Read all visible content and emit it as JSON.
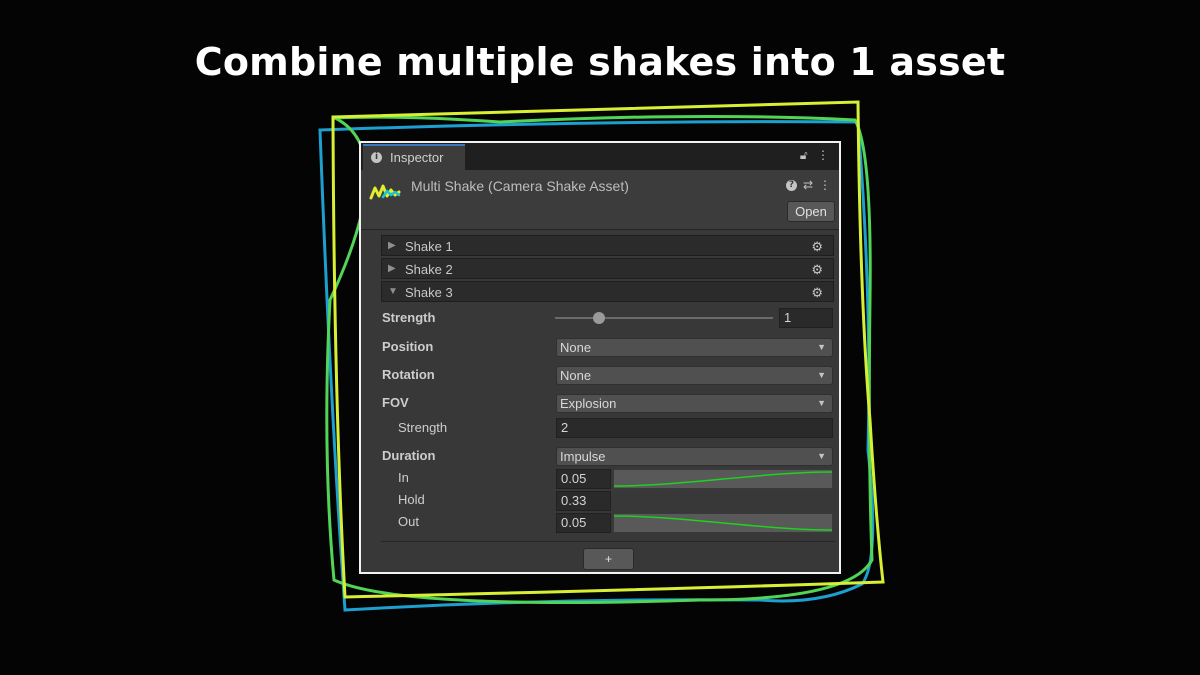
{
  "headline": "Combine multiple shakes into 1 asset",
  "inspector": {
    "tab_label": "Inspector",
    "tab_icon": "info-icon",
    "tab_tools": [
      "lock-icon",
      "kebab-menu-icon"
    ],
    "asset_title": "Multi Shake (Camera Shake Asset)",
    "header_tools": [
      "help-icon",
      "preset-settings-icon",
      "kebab-menu-icon"
    ],
    "open_label": "Open",
    "shakes": [
      {
        "label": "Shake 1",
        "expanded": false
      },
      {
        "label": "Shake 2",
        "expanded": false
      },
      {
        "label": "Shake 3",
        "expanded": true
      }
    ],
    "props": {
      "strength_label": "Strength",
      "strength_value": "1",
      "strength_slider_fraction": 0.2,
      "position_label": "Position",
      "position_value": "None",
      "rotation_label": "Rotation",
      "rotation_value": "None",
      "fov_label": "FOV",
      "fov_value": "Explosion",
      "fov_strength_label": "Strength",
      "fov_strength_value": "2",
      "duration_label": "Duration",
      "duration_value": "Impulse",
      "in_label": "In",
      "in_value": "0.05",
      "hold_label": "Hold",
      "hold_value": "0.33",
      "out_label": "Out",
      "out_value": "0.05"
    },
    "add_label": "+"
  },
  "colors": {
    "frame_yellow": "#d8ef33",
    "frame_green": "#52d457",
    "frame_blue": "#1d9fd0",
    "curve_green": "#1ed21e",
    "tab_accent": "#3a79bb"
  }
}
